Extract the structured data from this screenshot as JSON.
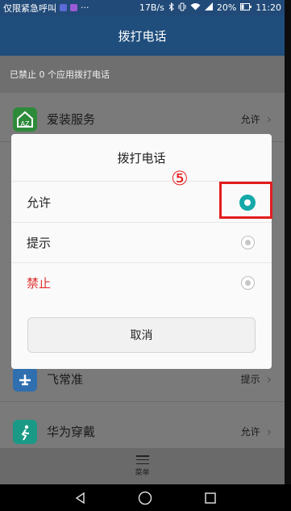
{
  "status_bar": {
    "carrier": "仅限紧急呼叫",
    "speed": "17B/s",
    "battery": "20%",
    "time": "11:20"
  },
  "header": {
    "title": "拨打电话"
  },
  "subheader": {
    "text": "已禁止 0 个应用拨打电话"
  },
  "apps": [
    {
      "name": "爱装服务",
      "status": "允许",
      "icon_color": "#2e8b3a"
    },
    {
      "name": "飞常准",
      "status": "提示",
      "icon_color": "#2f6fb0"
    },
    {
      "name": "华为穿戴",
      "status": "允许",
      "icon_color": "#1a9a86"
    }
  ],
  "dialog": {
    "title": "拨打电话",
    "options": [
      {
        "label": "允许",
        "selected": true
      },
      {
        "label": "提示",
        "selected": false
      },
      {
        "label": "禁止",
        "selected": false
      }
    ],
    "cancel_label": "取消"
  },
  "annotation": {
    "step_marker": "⑤",
    "color": "#e21d1d"
  },
  "bottom_menu": {
    "label": "菜单"
  },
  "colors": {
    "accent": "#14a8a8",
    "header_bg": "#1f4d7c",
    "danger": "#e03030"
  }
}
